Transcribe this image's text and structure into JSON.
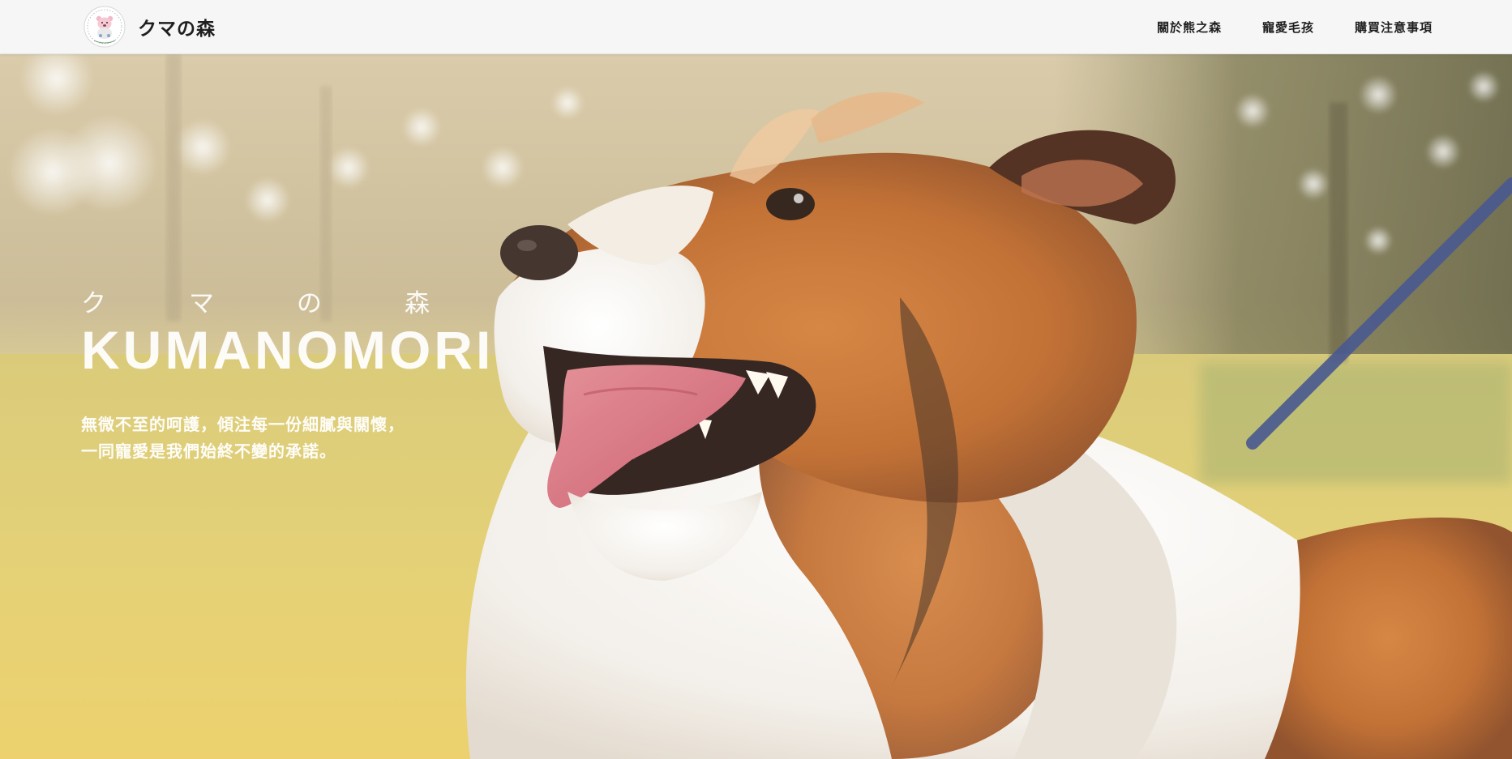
{
  "header": {
    "brand_name": "クマの森",
    "logo_icon": "bear-logo-icon",
    "nav": [
      {
        "label": "關於熊之森"
      },
      {
        "label": "寵愛毛孩"
      },
      {
        "label": "購買注意事項"
      }
    ]
  },
  "hero": {
    "kana": [
      "ク",
      "マ",
      "の",
      "森"
    ],
    "title": "KUMANOMORI",
    "description_lines": [
      "無微不至的呵護，傾注每一份細膩與關懷，",
      "一同寵愛是我們始終不變的承諾。"
    ],
    "image": "collie-dog-photo"
  },
  "colors": {
    "header_bg": "#f6f6f6",
    "text_dark": "#1f1f1f",
    "hero_text": "#ffffff",
    "dog_orange": "#c56f2c",
    "leash_blue": "#3e4f8a"
  }
}
